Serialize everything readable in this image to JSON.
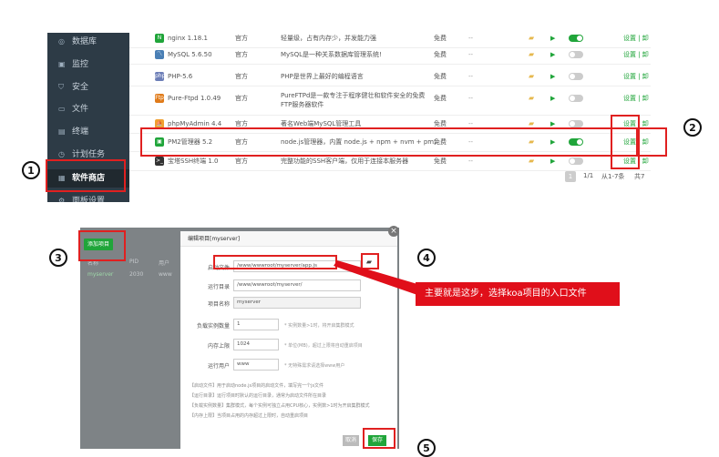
{
  "sidebar": {
    "items": [
      {
        "label": "数据库",
        "icon": "database-icon",
        "glyph": "◎"
      },
      {
        "label": "监控",
        "icon": "monitor-icon",
        "glyph": "▣"
      },
      {
        "label": "安全",
        "icon": "shield-icon",
        "glyph": "⛉"
      },
      {
        "label": "文件",
        "icon": "folder-icon",
        "glyph": "▭"
      },
      {
        "label": "终端",
        "icon": "terminal-icon",
        "glyph": "▤"
      },
      {
        "label": "计划任务",
        "icon": "clock-icon",
        "glyph": "◷"
      },
      {
        "label": "软件商店",
        "icon": "store-icon",
        "glyph": "▦"
      },
      {
        "label": "面板设置",
        "icon": "gear-icon",
        "glyph": "⚙"
      }
    ]
  },
  "software_table": {
    "rows": [
      {
        "name": "nginx 1.18.1",
        "type": "官方",
        "desc": "轻量级，占有内存少，并发能力强",
        "price": "免费",
        "dash": "--",
        "enabled": true,
        "ops": "设置 | 卸",
        "logo": "N",
        "logo_color": "#20a53a"
      },
      {
        "name": "MySQL 5.6.50",
        "type": "官方",
        "desc": "MySQL是一种关系数据库管理系统!",
        "price": "免费",
        "dash": "--",
        "enabled": false,
        "ops": "设置 | 卸",
        "logo": "〽",
        "logo_color": "#4a7fb5"
      },
      {
        "name": "PHP-5.6",
        "type": "官方",
        "desc": "PHP是世界上最好的编程语言",
        "price": "免费",
        "dash": "--",
        "enabled": false,
        "ops": "设置 | 卸",
        "logo": "php",
        "logo_color": "#6c7eb7"
      },
      {
        "name": "Pure-Ftpd 1.0.49",
        "type": "官方",
        "desc": "PureFTPd是一款专注于程序健壮和软件安全的免费FTP服务器软件",
        "price": "免费",
        "dash": "--",
        "enabled": false,
        "ops": "设置 | 卸",
        "logo": "Ftp",
        "logo_color": "#e07b1a"
      },
      {
        "name": "phpMyAdmin 4.4",
        "type": "官方",
        "desc": "著名Web端MySQL管理工具",
        "price": "免费",
        "dash": "--",
        "enabled": false,
        "ops": "设置 | 卸",
        "logo": "⛵",
        "logo_color": "#f0a030"
      },
      {
        "name": "PM2管理器 5.2",
        "type": "官方",
        "desc": "node.js管理器，内置 node.js + npm + nvm + pm2.",
        "price": "免费",
        "dash": "--",
        "enabled": true,
        "ops": "设置 | 卸",
        "logo": "▣",
        "logo_color": "#20a53a"
      },
      {
        "name": "宝塔SSH终端 1.0",
        "type": "官方",
        "desc": "完整功能的SSH客户端，仅用于连接本服务器",
        "price": "免费",
        "dash": "--",
        "enabled": false,
        "ops": "设置 | 卸",
        "logo": ">_",
        "logo_color": "#333333"
      }
    ]
  },
  "pager": {
    "page": "1",
    "total": "1/1",
    "range": "从1-7条",
    "count": "共7"
  },
  "markers": [
    "1",
    "2",
    "3",
    "4",
    "5"
  ],
  "background_list": {
    "add_button": "添加项目",
    "headers": [
      "名称",
      "PID",
      "用户"
    ],
    "row": [
      "myserver",
      "2030",
      "www"
    ]
  },
  "dialog": {
    "title": "编辑项目[myserver]",
    "fields": [
      {
        "label": "启动文件",
        "value": "/www/wwwroot/myserver/app.js"
      },
      {
        "label": "运行目录",
        "value": "/www/wwwroot/myserver/"
      },
      {
        "label": "项目名称",
        "value": "myserver"
      },
      {
        "label": "负载实例数量",
        "value": "1",
        "hint": "* 实例数量>1时，将开启集群模式"
      },
      {
        "label": "内存上限",
        "value": "1024",
        "hint": "* 单位(MB)，超过上限将自动重启项目"
      },
      {
        "label": "运行用户",
        "value": "www",
        "hint": "* 无特殊需求请选择www用户"
      }
    ],
    "tips": [
      "【启动文件】用于启动node.js项目的启动文件，填写完一个js文件",
      "【运行目录】运行项目时默认的运行目录，通常为启动文件所在目录",
      "【负载实例数量】集群模式，每个实例可独立占用CPU核心，实例数>1时为开启集群模式",
      "【内存上限】当项目占用的内存超过上限时，自动重启项目"
    ],
    "cancel_label": "取消",
    "save_label": "保存"
  },
  "callout": {
    "text": "主要就是这步，选择koa项目的入口文件"
  },
  "colors": {
    "accent": "#20a53a",
    "highlight": "#e02020",
    "sidebar": "#2d3b46"
  }
}
